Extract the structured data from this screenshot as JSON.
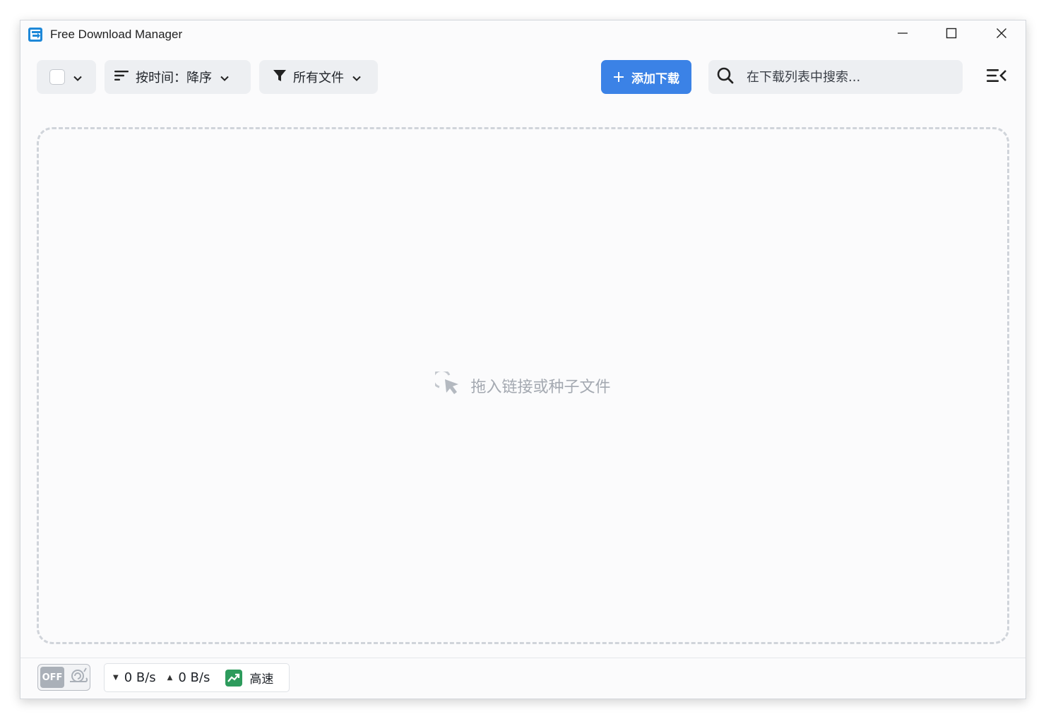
{
  "window": {
    "title": "Free Download Manager",
    "logo_icon": "fdm-logo-icon",
    "controls": [
      "minimize-icon",
      "maximize-icon",
      "close-icon"
    ]
  },
  "toolbar": {
    "select_all": {
      "checked": false
    },
    "sort_label": "按时间：降序",
    "filter_label": "所有文件",
    "add_download_label": "添加下载",
    "search_placeholder": "在下载列表中搜索..."
  },
  "dropzone": {
    "hint": "拖入链接或种子文件"
  },
  "status_bar": {
    "snail_mode_label": "OFF",
    "download_speed": "0 B/s",
    "upload_speed": "0 B/s",
    "speed_mode_label": "高速"
  },
  "colors": {
    "accent": "#3b82e6",
    "turbo": "#2d9b5c",
    "dropzone_border": "#d0d4da",
    "hint_text": "#a4a9b1"
  }
}
